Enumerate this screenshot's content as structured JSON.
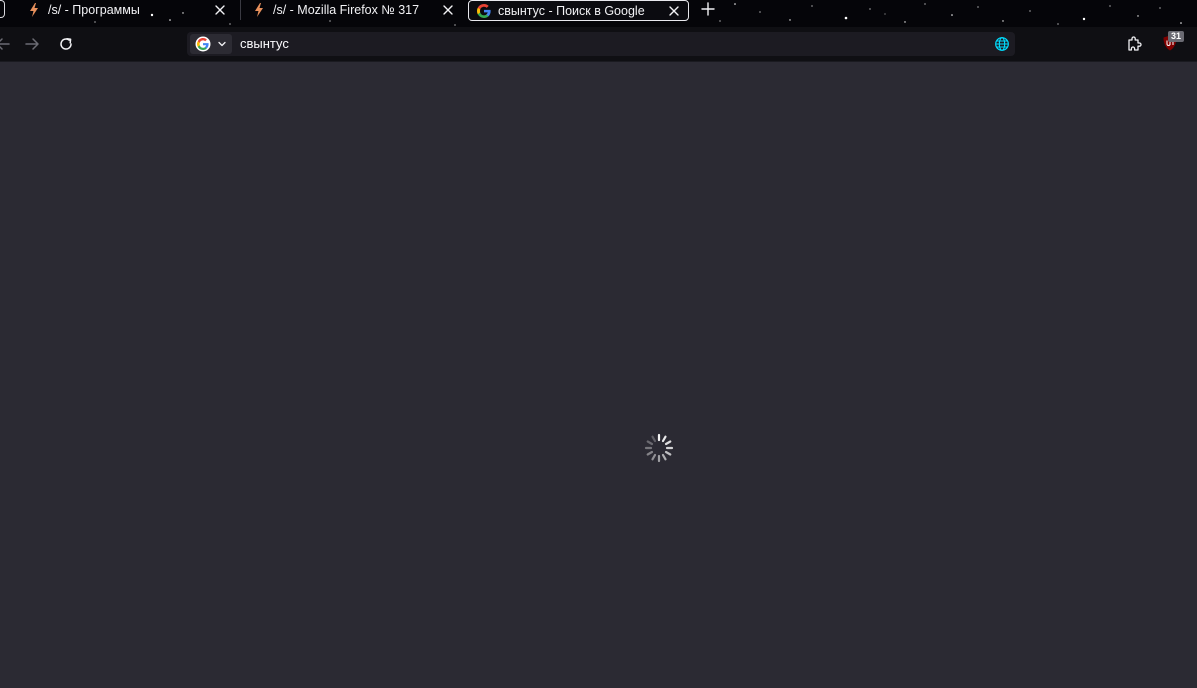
{
  "tabs": [
    {
      "title": "/s/ - Программы",
      "icon": "lightning-icon",
      "active": false
    },
    {
      "title": "/s/ - Mozilla Firefox № 317",
      "icon": "lightning-icon",
      "active": false
    },
    {
      "title": "свынтус - Поиск в Google",
      "icon": "google-g-icon",
      "active": true
    }
  ],
  "urlbar": {
    "value": "свынтус",
    "search_engine": "google-g-icon"
  },
  "toolbar": {
    "back_icon": "arrow-left-icon",
    "forward_icon": "arrow-right-icon",
    "reload_icon": "reload-icon",
    "extensions_icon": "puzzle-icon",
    "ublock_icon": "ublock-origin-icon",
    "ublock_badge": "31"
  },
  "content": {
    "state": "loading"
  },
  "colors": {
    "tabstrip_bg": "#050509",
    "navbar_bg": "#0f0f13",
    "urlbar_bg": "#1c1b22",
    "content_bg": "#2b2a33",
    "lightning": "#e7905c",
    "ublock_red": "#800000",
    "globe_accent": "#00ddff"
  }
}
